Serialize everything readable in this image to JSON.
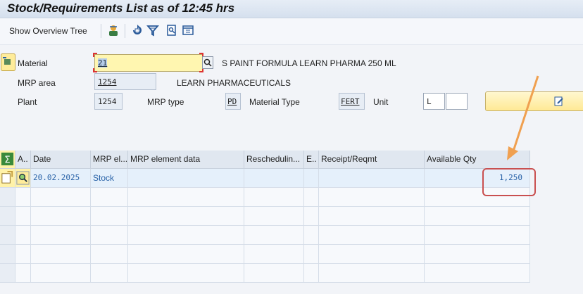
{
  "title": "Stock/Requirements List as of 12:45 hrs",
  "toolbar": {
    "show_overview_tree": "Show Overview Tree"
  },
  "form": {
    "material_label": "Material",
    "material_value": "21",
    "material_desc": "S PAINT FORMULA LEARN PHARMA 250 ML",
    "mrp_area_label": "MRP area",
    "mrp_area_value": "1254",
    "mrp_area_desc": "LEARN PHARMACEUTICALS",
    "plant_label": "Plant",
    "plant_value": "1254",
    "mrp_type_label": "MRP type",
    "mrp_type_value": "PD",
    "material_type_label": "Material Type",
    "material_type_value": "FERT",
    "unit_label": "Unit",
    "unit_value": "L"
  },
  "grid": {
    "columns": [
      "A..",
      "Date",
      "MRP el...",
      "MRP element data",
      "Reschedulin...",
      "E..",
      "Receipt/Reqmt",
      "Available Qty"
    ],
    "rows": [
      {
        "date": "20.02.2025",
        "mrp_element": "Stock",
        "mrp_element_data": "",
        "rescheduling": "",
        "e": "",
        "receipt_reqmt": "",
        "available_qty": "1,250"
      }
    ]
  },
  "colors": {
    "accent_arrow": "#f0a050",
    "highlight_box": "#c95050",
    "link_text": "#2a63a8",
    "yellow_field": "#fff6b0"
  },
  "icons": [
    "manager-icon",
    "refresh-icon",
    "filter-icon",
    "find-icon",
    "settings-icon",
    "enter-icon",
    "search-help-icon",
    "edit-icon",
    "sum-icon",
    "detail-icon"
  ]
}
